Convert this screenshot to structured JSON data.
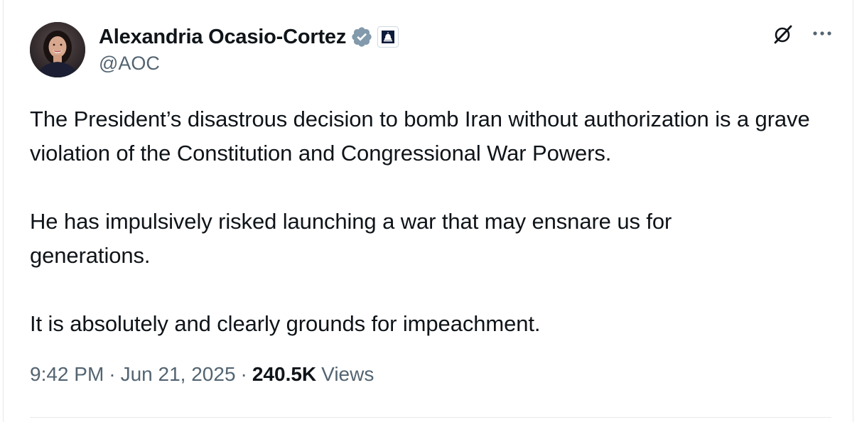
{
  "author": {
    "display_name": "Alexandria Ocasio-Cortez",
    "handle": "@AOC",
    "verified_icon": "verified-badge-icon",
    "affiliation_icon": "capitol-dome-icon"
  },
  "actions": {
    "grok_icon": "grok-icon",
    "more_icon": "more-options-icon"
  },
  "tweet": {
    "paragraphs": [
      "The President’s disastrous decision to bomb Iran without authorization is a grave violation of the Constitution and Congressional War Powers.",
      "He has impulsively risked launching a war that may ensnare us for generations.",
      "It is absolutely and clearly grounds for impeachment."
    ]
  },
  "meta": {
    "time": "9:42 PM",
    "separator": "·",
    "date": "Jun 21, 2025",
    "views_count": "240.5K",
    "views_label": "Views"
  },
  "colors": {
    "text_primary": "#0f1419",
    "text_secondary": "#536471",
    "verified_badge": "#829aab",
    "divider": "#e6e9ec"
  }
}
